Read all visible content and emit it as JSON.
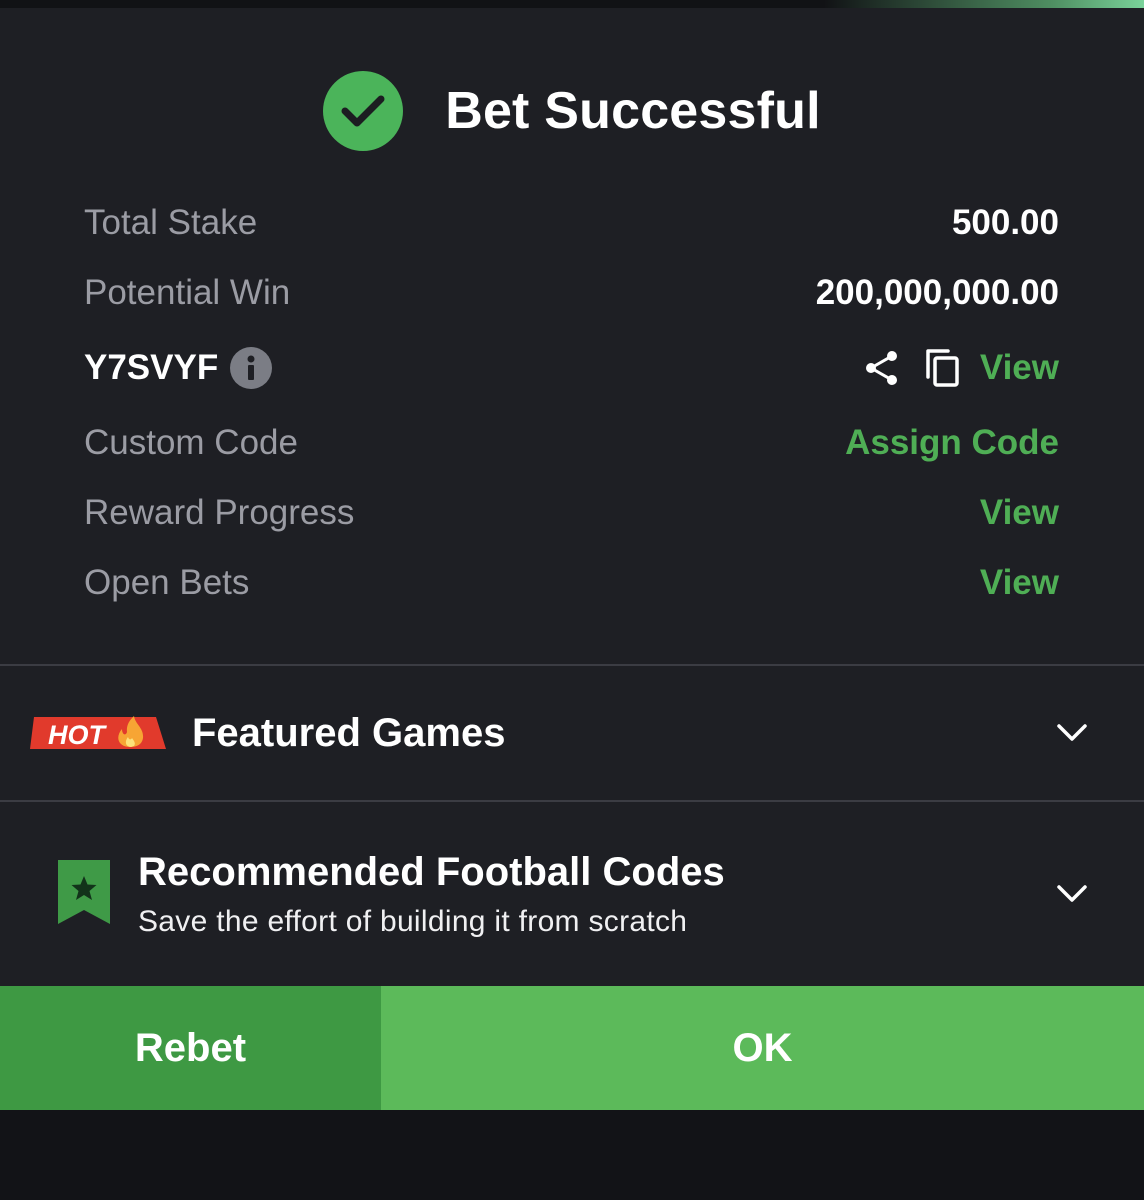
{
  "header": {
    "title": "Bet Successful"
  },
  "summary": {
    "total_stake_label": "Total Stake",
    "total_stake_value": "500.00",
    "potential_win_label": "Potential Win",
    "potential_win_value": "200,000,000.00",
    "booking_code": "Y7SVYF",
    "booking_view_label": "View",
    "custom_code_label": "Custom Code",
    "custom_code_action": "Assign Code",
    "reward_progress_label": "Reward Progress",
    "reward_progress_action": "View",
    "open_bets_label": "Open Bets",
    "open_bets_action": "View"
  },
  "featured": {
    "badge": "HOT",
    "title": "Featured Games"
  },
  "recommended": {
    "title": "Recommended Football Codes",
    "subtitle": "Save the effort of building it from scratch"
  },
  "actions": {
    "rebet_label": "Rebet",
    "ok_label": "OK"
  },
  "colors": {
    "accent_green": "#4fae55",
    "ok_button": "#5cba5a",
    "rebet_button": "#3e9943",
    "hot_badge": "#e13a2c",
    "panel_background": "#1e1f24"
  },
  "icons": [
    "check-circle-icon",
    "info-icon",
    "share-icon",
    "copy-icon",
    "hot-flame-badge",
    "chevron-down-icon",
    "bookmark-star-icon"
  ]
}
